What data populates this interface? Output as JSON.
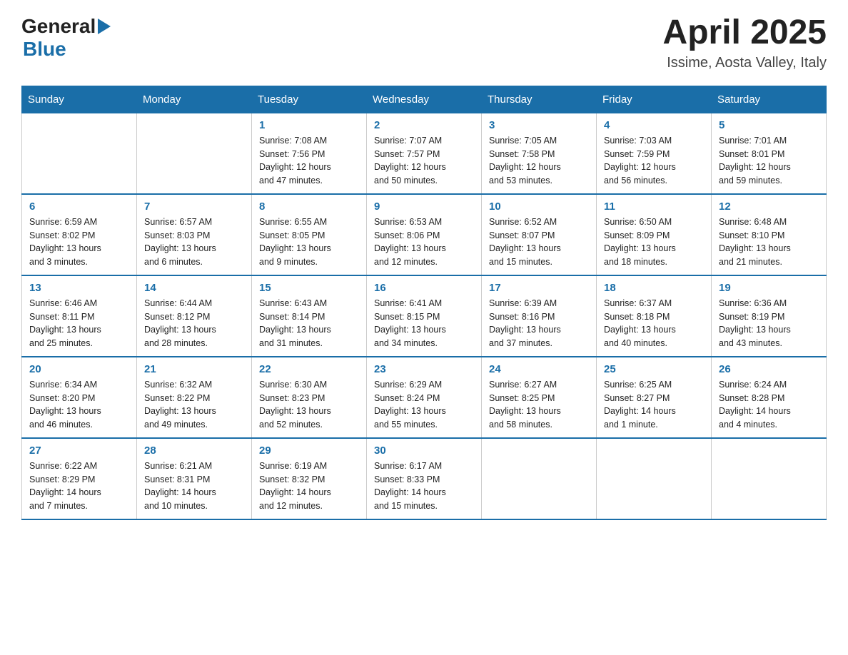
{
  "header": {
    "logo": {
      "general": "General",
      "blue": "Blue"
    },
    "title": "April 2025",
    "subtitle": "Issime, Aosta Valley, Italy"
  },
  "calendar": {
    "days_of_week": [
      "Sunday",
      "Monday",
      "Tuesday",
      "Wednesday",
      "Thursday",
      "Friday",
      "Saturday"
    ],
    "weeks": [
      [
        {
          "day": "",
          "info": ""
        },
        {
          "day": "",
          "info": ""
        },
        {
          "day": "1",
          "info": "Sunrise: 7:08 AM\nSunset: 7:56 PM\nDaylight: 12 hours\nand 47 minutes."
        },
        {
          "day": "2",
          "info": "Sunrise: 7:07 AM\nSunset: 7:57 PM\nDaylight: 12 hours\nand 50 minutes."
        },
        {
          "day": "3",
          "info": "Sunrise: 7:05 AM\nSunset: 7:58 PM\nDaylight: 12 hours\nand 53 minutes."
        },
        {
          "day": "4",
          "info": "Sunrise: 7:03 AM\nSunset: 7:59 PM\nDaylight: 12 hours\nand 56 minutes."
        },
        {
          "day": "5",
          "info": "Sunrise: 7:01 AM\nSunset: 8:01 PM\nDaylight: 12 hours\nand 59 minutes."
        }
      ],
      [
        {
          "day": "6",
          "info": "Sunrise: 6:59 AM\nSunset: 8:02 PM\nDaylight: 13 hours\nand 3 minutes."
        },
        {
          "day": "7",
          "info": "Sunrise: 6:57 AM\nSunset: 8:03 PM\nDaylight: 13 hours\nand 6 minutes."
        },
        {
          "day": "8",
          "info": "Sunrise: 6:55 AM\nSunset: 8:05 PM\nDaylight: 13 hours\nand 9 minutes."
        },
        {
          "day": "9",
          "info": "Sunrise: 6:53 AM\nSunset: 8:06 PM\nDaylight: 13 hours\nand 12 minutes."
        },
        {
          "day": "10",
          "info": "Sunrise: 6:52 AM\nSunset: 8:07 PM\nDaylight: 13 hours\nand 15 minutes."
        },
        {
          "day": "11",
          "info": "Sunrise: 6:50 AM\nSunset: 8:09 PM\nDaylight: 13 hours\nand 18 minutes."
        },
        {
          "day": "12",
          "info": "Sunrise: 6:48 AM\nSunset: 8:10 PM\nDaylight: 13 hours\nand 21 minutes."
        }
      ],
      [
        {
          "day": "13",
          "info": "Sunrise: 6:46 AM\nSunset: 8:11 PM\nDaylight: 13 hours\nand 25 minutes."
        },
        {
          "day": "14",
          "info": "Sunrise: 6:44 AM\nSunset: 8:12 PM\nDaylight: 13 hours\nand 28 minutes."
        },
        {
          "day": "15",
          "info": "Sunrise: 6:43 AM\nSunset: 8:14 PM\nDaylight: 13 hours\nand 31 minutes."
        },
        {
          "day": "16",
          "info": "Sunrise: 6:41 AM\nSunset: 8:15 PM\nDaylight: 13 hours\nand 34 minutes."
        },
        {
          "day": "17",
          "info": "Sunrise: 6:39 AM\nSunset: 8:16 PM\nDaylight: 13 hours\nand 37 minutes."
        },
        {
          "day": "18",
          "info": "Sunrise: 6:37 AM\nSunset: 8:18 PM\nDaylight: 13 hours\nand 40 minutes."
        },
        {
          "day": "19",
          "info": "Sunrise: 6:36 AM\nSunset: 8:19 PM\nDaylight: 13 hours\nand 43 minutes."
        }
      ],
      [
        {
          "day": "20",
          "info": "Sunrise: 6:34 AM\nSunset: 8:20 PM\nDaylight: 13 hours\nand 46 minutes."
        },
        {
          "day": "21",
          "info": "Sunrise: 6:32 AM\nSunset: 8:22 PM\nDaylight: 13 hours\nand 49 minutes."
        },
        {
          "day": "22",
          "info": "Sunrise: 6:30 AM\nSunset: 8:23 PM\nDaylight: 13 hours\nand 52 minutes."
        },
        {
          "day": "23",
          "info": "Sunrise: 6:29 AM\nSunset: 8:24 PM\nDaylight: 13 hours\nand 55 minutes."
        },
        {
          "day": "24",
          "info": "Sunrise: 6:27 AM\nSunset: 8:25 PM\nDaylight: 13 hours\nand 58 minutes."
        },
        {
          "day": "25",
          "info": "Sunrise: 6:25 AM\nSunset: 8:27 PM\nDaylight: 14 hours\nand 1 minute."
        },
        {
          "day": "26",
          "info": "Sunrise: 6:24 AM\nSunset: 8:28 PM\nDaylight: 14 hours\nand 4 minutes."
        }
      ],
      [
        {
          "day": "27",
          "info": "Sunrise: 6:22 AM\nSunset: 8:29 PM\nDaylight: 14 hours\nand 7 minutes."
        },
        {
          "day": "28",
          "info": "Sunrise: 6:21 AM\nSunset: 8:31 PM\nDaylight: 14 hours\nand 10 minutes."
        },
        {
          "day": "29",
          "info": "Sunrise: 6:19 AM\nSunset: 8:32 PM\nDaylight: 14 hours\nand 12 minutes."
        },
        {
          "day": "30",
          "info": "Sunrise: 6:17 AM\nSunset: 8:33 PM\nDaylight: 14 hours\nand 15 minutes."
        },
        {
          "day": "",
          "info": ""
        },
        {
          "day": "",
          "info": ""
        },
        {
          "day": "",
          "info": ""
        }
      ]
    ]
  }
}
